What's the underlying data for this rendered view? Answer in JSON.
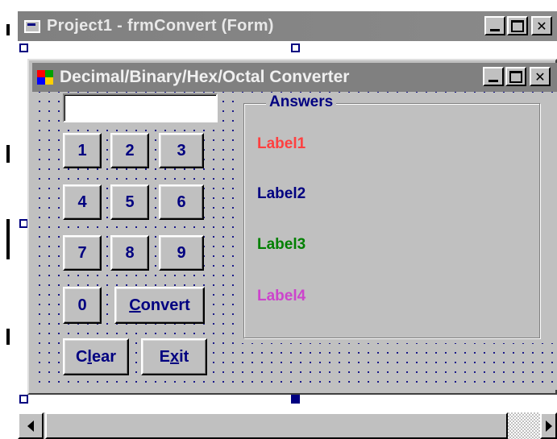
{
  "ide_window": {
    "title": "Project1 - frmConvert (Form)"
  },
  "form": {
    "caption": "Decimal/Binary/Hex/Octal Converter",
    "input_value": "",
    "digit_buttons": [
      "1",
      "2",
      "3",
      "4",
      "5",
      "6",
      "7",
      "8",
      "9",
      "0"
    ],
    "convert_button": {
      "label_pre": "",
      "accel": "C",
      "label_post": "onvert"
    },
    "clear_button": {
      "label_pre": "C",
      "accel": "l",
      "label_post": "ear"
    },
    "exit_button": {
      "label_pre": "E",
      "accel": "x",
      "label_post": "it"
    },
    "answers_frame": {
      "caption": "Answers",
      "labels": [
        {
          "text": "Label1",
          "color": "#ff4040"
        },
        {
          "text": "Label2",
          "color": "#000080"
        },
        {
          "text": "Label3",
          "color": "#008000"
        },
        {
          "text": "Label4",
          "color": "#cc44cc"
        }
      ]
    }
  },
  "icons": {
    "ide_system_icon": "form-icon",
    "form_system_icon": "vb-windows-icon",
    "minimize": "minimize-icon",
    "maximize": "maximize-icon",
    "close": "close-icon",
    "scroll_left": "arrow-left-icon",
    "scroll_right": "arrow-right-icon"
  },
  "colors": {
    "title_inactive": "#808080",
    "accent": "#000080",
    "face": "#c0c0c0"
  }
}
